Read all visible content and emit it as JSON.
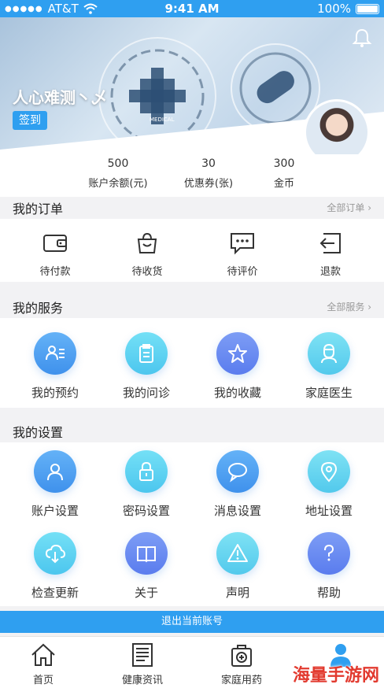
{
  "status_bar": {
    "carrier": "AT&T",
    "signal": "●●●●●",
    "time": "9:41 AM",
    "battery": "100%"
  },
  "header": {
    "username": "人心难测丶乄",
    "checkin_label": "签到",
    "image_caption": "MEDICAL"
  },
  "stats": [
    {
      "value": "500",
      "label": "账户余额(元)"
    },
    {
      "value": "30",
      "label": "优惠券(张)"
    },
    {
      "value": "300",
      "label": "金币"
    }
  ],
  "orders": {
    "title": "我的订单",
    "more": "全部订单 ›",
    "items": [
      {
        "label": "待付款",
        "icon": "wallet-icon"
      },
      {
        "label": "待收货",
        "icon": "bag-icon"
      },
      {
        "label": "待评价",
        "icon": "comment-icon"
      },
      {
        "label": "退款",
        "icon": "refund-icon"
      }
    ]
  },
  "services": {
    "title": "我的服务",
    "more": "全部服务 ›",
    "items": [
      {
        "label": "我的预约",
        "icon": "appointment-icon"
      },
      {
        "label": "我的问诊",
        "icon": "clipboard-icon"
      },
      {
        "label": "我的收藏",
        "icon": "star-icon"
      },
      {
        "label": "家庭医生",
        "icon": "doctor-icon"
      }
    ]
  },
  "settings": {
    "title": "我的设置",
    "items": [
      {
        "label": "账户设置",
        "icon": "user-icon"
      },
      {
        "label": "密码设置",
        "icon": "lock-icon"
      },
      {
        "label": "消息设置",
        "icon": "message-icon"
      },
      {
        "label": "地址设置",
        "icon": "location-icon"
      },
      {
        "label": "检查更新",
        "icon": "cloud-download-icon"
      },
      {
        "label": "关于",
        "icon": "book-icon"
      },
      {
        "label": "声明",
        "icon": "warning-icon"
      },
      {
        "label": "帮助",
        "icon": "question-icon"
      }
    ]
  },
  "logout_label": "退出当前账号",
  "tabbar": [
    {
      "label": "首页",
      "icon": "home-icon"
    },
    {
      "label": "健康资讯",
      "icon": "news-icon"
    },
    {
      "label": "家庭用药",
      "icon": "medicine-kit-icon"
    },
    {
      "label": "",
      "icon": "profile-icon"
    }
  ],
  "watermark": "海量手游网",
  "colors": {
    "primary": "#2f9ff0",
    "background": "#f2f2f4"
  }
}
